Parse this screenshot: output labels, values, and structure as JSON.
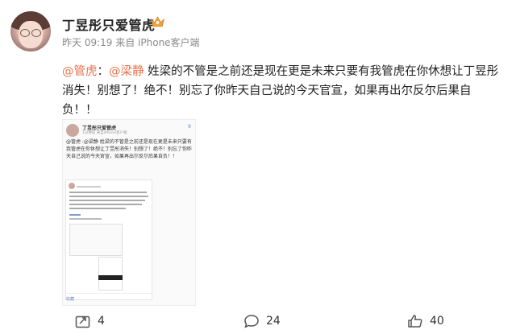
{
  "post": {
    "author": "丁昱彤只爱管虎",
    "time": "昨天 09:19",
    "source": "来自 iPhone客户端",
    "mention1": "@管虎",
    "colon": "：",
    "mention2": "@梁静",
    "body": " 姓梁的不管是之前还是现在更是未来只要有我管虎在你休想让丁昱彤消失！别想了！绝不！别忘了你昨天自己说的今天官宣，如果再出尔反尔后果自负！！"
  },
  "embedded_screenshot": {
    "author": "丁昱彤只爱管虎",
    "meta": "1分钟前 来自iPhone客户端",
    "count": "9",
    "text": "@管虎 :@梁静 姓梁的不管是之前还是现在更是未来只要有我管虎在你休想让丁昱彤消失！别想了！绝不！别忘了你昨天自己说的今天官宣，如果再出尔反尔后果自负！！",
    "footer": "收藏"
  },
  "actions": {
    "repost_count": "4",
    "comment_count": "24",
    "like_count": "40"
  }
}
